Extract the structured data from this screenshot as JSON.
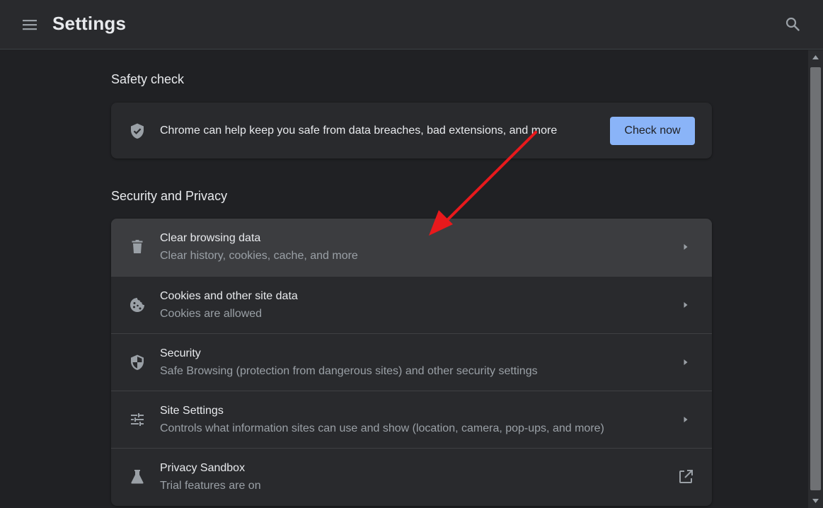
{
  "header": {
    "title": "Settings",
    "menu_icon": "hamburger-menu-icon",
    "search_icon": "search-icon"
  },
  "safety_check": {
    "heading": "Safety check",
    "message": "Chrome can help keep you safe from data breaches, bad extensions, and more",
    "button_label": "Check now",
    "icon": "shield-check-icon"
  },
  "security_privacy": {
    "heading": "Security and Privacy",
    "items": [
      {
        "title": "Clear browsing data",
        "subtitle": "Clear history, cookies, cache, and more",
        "icon": "trash-icon",
        "highlighted": true
      },
      {
        "title": "Cookies and other site data",
        "subtitle": "Cookies are allowed",
        "icon": "cookie-icon"
      },
      {
        "title": "Security",
        "subtitle": "Safe Browsing (protection from dangerous sites) and other security settings",
        "icon": "shield-icon"
      },
      {
        "title": "Site Settings",
        "subtitle": "Controls what information sites can use and show (location, camera, pop-ups, and more)",
        "icon": "tune-icon"
      },
      {
        "title": "Privacy Sandbox",
        "subtitle": "Trial features are on",
        "icon": "flask-icon",
        "external": true
      }
    ]
  },
  "colors": {
    "accent": "#8ab4f8",
    "background": "#202124",
    "surface": "#292a2d",
    "annotation_arrow": "#e8191c"
  }
}
